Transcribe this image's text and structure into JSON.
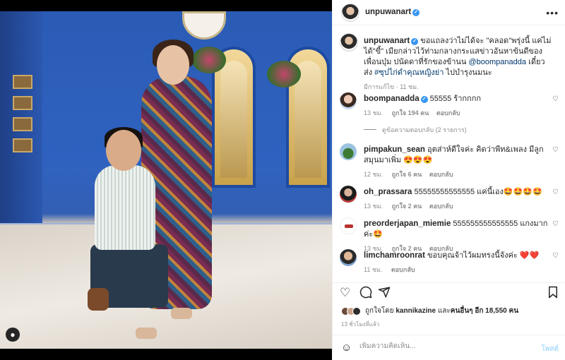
{
  "post": {
    "owner": "unpuwanart",
    "caption_user": "unpuwanart",
    "caption_text": "ขอแถลงว่าไม่ได้จะ \"คลอด\"พรุ่งนี้ แค่ไม่ได้\"ขี้\" เมียกล่าวไว้ท่ามกลางกระแสข่าวอันหาข้นดีของเพื่อนบุ๋ม ปนัดดาที่รักของข้านน ",
    "caption_mention": "@boompanadda",
    "caption_mid": " เดี๋ยวส่ง ",
    "caption_hashtag": "#ซุปไก่ดำคุณหญิงย่า",
    "caption_end": " ไปบำรุงนมนะ",
    "caption_meta": "มีการแก้ไข · 11 ชม.",
    "likes_prefix": "ถูกใจโดย",
    "likes_user": "kannikazine",
    "likes_and": "และ",
    "likes_others": "คนอื่นๆ อีก 18,550 คน",
    "time_ago": "13 ชั่วโมงที่แล้ว"
  },
  "comments": [
    {
      "user": "boompanadda",
      "verified": true,
      "text": "55555 ร้ากกกก",
      "time": "13 ชม.",
      "likes": "ถูกใจ 194 คน",
      "reply": "ตอบกลับ",
      "view_replies": "ดูข้อความตอบกลับ (2 รายการ)"
    },
    {
      "user": "pimpakun_sean",
      "text": "อุตส่าห์ดีใจค่ะ คิดว่าพีท&เพลง มีลูกสมุนมาเพิ่ม 😍😍😍",
      "time": "12 ชม.",
      "likes": "ถูกใจ 6 คน",
      "reply": "ตอบกลับ"
    },
    {
      "user": "oh_prassara",
      "text": "55555555555555 แค่นี้เอง🤩🤩🤩🤩",
      "time": "13 ชม.",
      "likes": "ถูกใจ 2 คน",
      "reply": "ตอบกลับ"
    },
    {
      "user": "preorderjapan_miemie",
      "text": "555555555555555 แกงมากค่ะ🤩",
      "time": "13 ชม.",
      "likes": "ถูกใจ 2 คน",
      "reply": "ตอบกลับ"
    },
    {
      "user": "limchamroonrat",
      "text": "ขอบคุณจ้าไว้ผมทรงนี้จังค่ะ ❤️❤️",
      "time": "11 ชม.",
      "reply": "ตอบกลับ"
    }
  ],
  "composer": {
    "placeholder": "เพิ่มความคิดเห็น...",
    "post_label": "โพสต์"
  },
  "icons": {
    "more": "more-options-icon",
    "heart": "heart-icon",
    "comment": "comment-icon",
    "share": "share-icon",
    "save": "bookmark-icon",
    "emoji": "emoji-icon",
    "user_tag": "person-tag-icon"
  },
  "colors": {
    "verified": "#3897f0",
    "link": "#00376b",
    "muted": "#8e8e8e",
    "post_button": "#b2dffc"
  }
}
